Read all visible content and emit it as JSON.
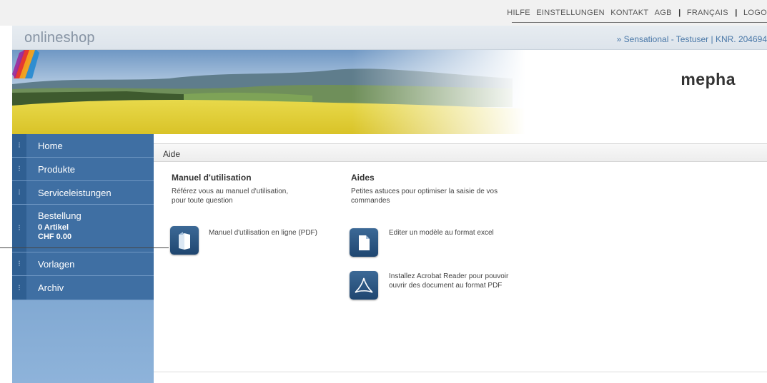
{
  "topnav": {
    "links": [
      "HILFE",
      "EINSTELLUNGEN",
      "KONTAKT",
      "AGB"
    ],
    "language": "FRANÇAIS",
    "logout": "LOGO"
  },
  "header": {
    "brand": "onlineshop",
    "user_info": "» Sensational - Testuser | KNR. 204694"
  },
  "banner": {
    "logo_text": "mepha"
  },
  "sidebar": {
    "items": [
      {
        "label": "Home"
      },
      {
        "label": "Produkte"
      },
      {
        "label": "Serviceleistungen"
      },
      {
        "label": "Bestellung",
        "sub1": "0 Artikel",
        "sub2": "CHF 0.00"
      },
      {
        "label": "Vorlagen"
      },
      {
        "label": "Archiv"
      }
    ],
    "bullet": "⁝"
  },
  "main": {
    "breadcrumb": "Aide",
    "manual": {
      "title": "Manuel d'utilisation",
      "desc_line1": "Référez vous au manuel d'utilisation,",
      "desc_line2": "pour toute question",
      "link": "Manuel d'utilisation en ligne (PDF)"
    },
    "aides": {
      "title": "Aides",
      "desc_line1": "Petites astuces pour optimiser la saisie de vos",
      "desc_line2": "commandes",
      "link1": "Editer un modèle au format excel",
      "link2_line1": "Installez Acrobat Reader pour pouvoir",
      "link2_line2": "ouvrir des document au format PDF"
    }
  },
  "colors": {
    "sidebar_item": "#3f6fa3",
    "sidebar_bg": "#7fa7d1",
    "link_blue": "#4a78a8"
  }
}
